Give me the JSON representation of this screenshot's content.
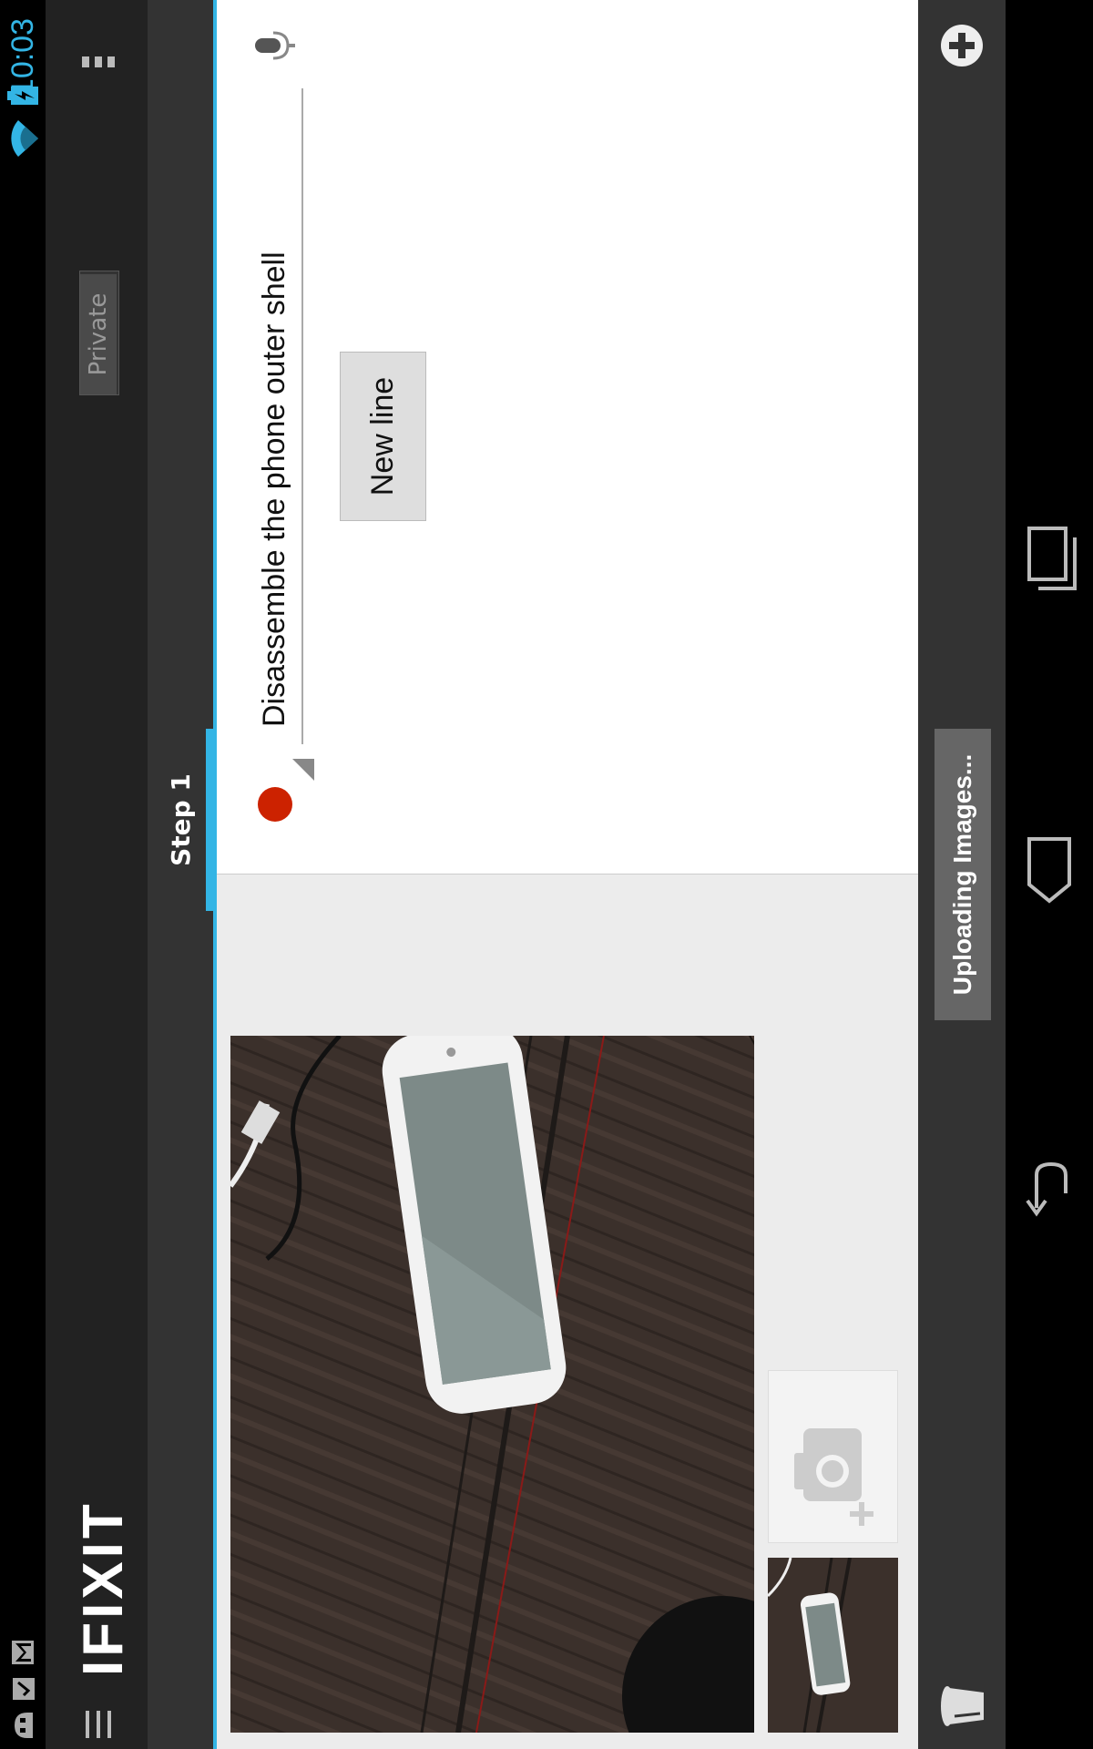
{
  "status_bar": {
    "time": "10:03",
    "icons": [
      "notification-icon",
      "checklist-icon",
      "gmail-icon",
      "wifi-icon",
      "battery-charging-icon"
    ]
  },
  "action_bar": {
    "menu_icon": "drawer-menu-icon",
    "logo_text": "IFIXIT",
    "private_label": "Private",
    "overflow_icon": "overflow-menu-icon"
  },
  "tabs": [
    {
      "label": "Step 1",
      "selected": true
    }
  ],
  "editor": {
    "bullet_color": "#cc2200",
    "line_text": "Disassemble the phone outer shell",
    "mic_icon": "microphone-icon",
    "new_line_label": "New line"
  },
  "images": {
    "main_alt": "phone-photo",
    "add_photo_icon": "add-camera-icon"
  },
  "bottom_bar": {
    "trash_icon": "trash-icon",
    "upload_label": "Uploading Images...",
    "add_step_icon": "add-circle-icon"
  },
  "nav_bar": {
    "icons": [
      "back-icon",
      "home-icon",
      "recent-apps-icon"
    ]
  },
  "colors": {
    "accent": "#33b5e5",
    "action_bar": "#222222",
    "tab_strip": "#333333"
  }
}
